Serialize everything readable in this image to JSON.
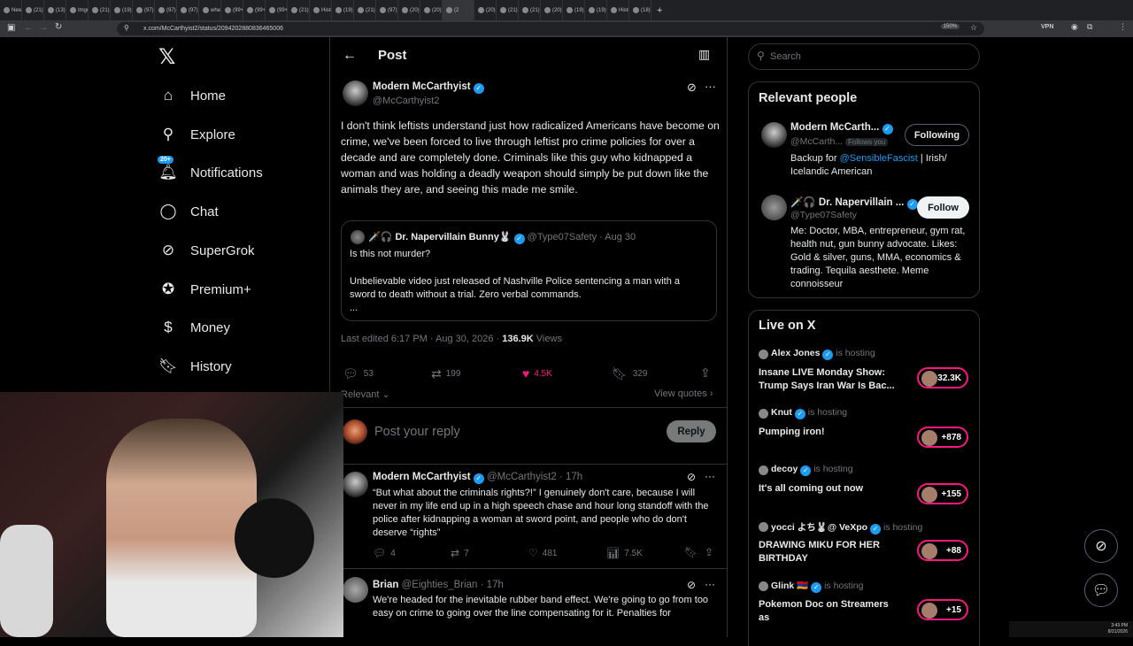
{
  "browser": {
    "tabs": [
      "New T",
      "(21) H",
      "(13) w",
      "Imgur",
      "(21) L",
      "(19) H",
      "(97) b",
      "(97) b",
      "(97) R",
      "when",
      "(99+)",
      "(99+)",
      "(99+)",
      "(21) a",
      "Histo",
      "(19) H",
      "(21) H",
      "(97) Y",
      "(20) D",
      "(20) H",
      "(2",
      "(20)",
      "(21) T",
      "(21) H",
      "(20) H",
      "(19) H",
      "(19) H",
      "Histo",
      "(18) L"
    ],
    "url": "x.com/McCarthyist2/status/2094202880836465006",
    "zoom": "150%",
    "vpn": "VPN"
  },
  "sidebar": {
    "items": [
      {
        "label": "Home",
        "icon": "home-icon"
      },
      {
        "label": "Explore",
        "icon": "search-icon"
      },
      {
        "label": "Notifications",
        "icon": "bell-icon",
        "badge": "20+"
      },
      {
        "label": "Chat",
        "icon": "chat-icon"
      },
      {
        "label": "SuperGrok",
        "icon": "grok-icon"
      },
      {
        "label": "Premium+",
        "icon": "verified-badge-icon"
      },
      {
        "label": "Money",
        "icon": "dollar-icon"
      },
      {
        "label": "History",
        "icon": "bookmark-icon"
      }
    ]
  },
  "post": {
    "header_title": "Post",
    "author_name": "Modern McCarthyist",
    "author_handle": "@McCarthyist2",
    "text": "I don't think leftists understand just how radicalized Americans have become on crime, we've been forced to live through leftist pro crime policies for over a decade and are completely done. Criminals like this guy who kidnapped a woman and was holding a deadly weapon should simply be put down like the animals they are, and seeing this made me smile.",
    "quote": {
      "author_name": "Dr. Napervillain Bunny🐰",
      "author_prefix": "🗡️🎧",
      "handle": "@Type07Safety",
      "date": "· Aug 30",
      "line1": "Is this not murder?",
      "line2": "Unbelievable video just released of Nashville Police sentencing a man with a sword to death without a trial. Zero verbal commands.",
      "ellipsis": "..."
    },
    "meta_edited": "Last edited 6:17 PM · Aug 30, 2026 ·",
    "views_count": "136.9K",
    "views_label": "Views",
    "replies": "53",
    "reposts": "199",
    "likes": "4.5K",
    "bookmarks": "329",
    "sort_label": "Relevant",
    "view_quotes": "View quotes",
    "reply_placeholder": "Post your reply",
    "reply_button": "Reply"
  },
  "replies": [
    {
      "name": "Modern McCarthyist",
      "handle": "@McCarthyist2",
      "time": "· 17h",
      "text": "“But what about the criminals rights?!” I genuinely don't care, because I will never in my life end up in a high speech chase and hour long standoff with the police after kidnapping a woman at sword point, and people who do don't deserve “rights”",
      "replies": "4",
      "reposts": "7",
      "likes": "481",
      "views": "7.5K"
    },
    {
      "name": "Brian",
      "handle": "@Eighties_Brian",
      "time": "· 17h",
      "text": "We're headed for the inevitable rubber band effect. We're going to go from too easy on crime to going over the line compensating for it. Penalties for"
    }
  ],
  "right": {
    "search_placeholder": "Search",
    "relevant_title": "Relevant people",
    "people": [
      {
        "name": "Modern McCarth...",
        "handle": "@McCarth...",
        "follows_you": "Follows you",
        "button": "Following",
        "bio_pre": "Backup for ",
        "bio_link": "@SensibleFascist",
        "bio_post": " | Irish/ Icelandic American"
      },
      {
        "name": "Dr. Napervillain ...",
        "prefix": "🗡️🎧",
        "handle": "@Type07Safety",
        "button": "Follow",
        "bio": "Me: Doctor, MBA, entrepreneur, gym rat, health nut, gun bunny advocate. Likes: Gold & silver, guns, MMA, economics & trading. Tequila aesthete. Meme connoisseur"
      }
    ],
    "live_title": "Live on X",
    "hosting_label": "is hosting",
    "live": [
      {
        "host": "Alex Jones",
        "title": "Insane LIVE Monday Show: Trump Says Iran War Is Bac...",
        "count": "+32.3K"
      },
      {
        "host": "Knut",
        "title": "Pumping iron!",
        "count": "+878"
      },
      {
        "host": "decoy",
        "title": "It's all coming out now",
        "count": "+155"
      },
      {
        "host": "yocci よち🐰@ VeXpo",
        "title": "DRAWING MIKU FOR HER BIRTHDAY",
        "count": "+88"
      },
      {
        "host": "Glink 🇦🇲",
        "title": "Pokemon Doc on Streamers as",
        "count": "+15"
      }
    ]
  },
  "taskbar": {
    "time": "3:43 PM",
    "date": "8/31/2026"
  },
  "colors": {
    "accent": "#1d9bf0",
    "like": "#f91880",
    "bg": "#000000",
    "border": "#2f3336",
    "muted": "#71767b"
  }
}
